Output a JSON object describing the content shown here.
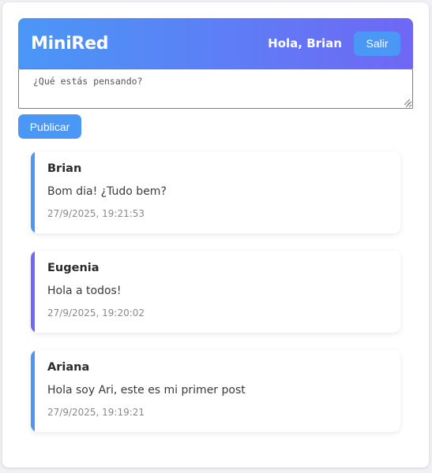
{
  "colors": {
    "header_gradient_start": "#4a97f6",
    "header_gradient_end": "#6f67f5",
    "button": "#4a97f6",
    "accent_blue": "#4a97f6",
    "accent_purple": "#6f67f5"
  },
  "header": {
    "brand": "MiniRed",
    "greeting": "Hola, Brian",
    "logout_label": "Salir"
  },
  "composer": {
    "placeholder": "¿Qué estás pensando?",
    "value": "",
    "publish_label": "Publicar"
  },
  "feed": {
    "posts": [
      {
        "author": "Brian",
        "content": "Bom dia! ¿Tudo bem?",
        "timestamp": "27/9/2025, 19:21:53",
        "accent": "#4a97f6"
      },
      {
        "author": "Eugenia",
        "content": "Hola a todos!",
        "timestamp": "27/9/2025, 19:20:02",
        "accent": "#6f67f5"
      },
      {
        "author": "Ariana",
        "content": "Hola soy Ari, este es mi primer post",
        "timestamp": "27/9/2025, 19:19:21",
        "accent": "#4a97f6"
      }
    ]
  }
}
